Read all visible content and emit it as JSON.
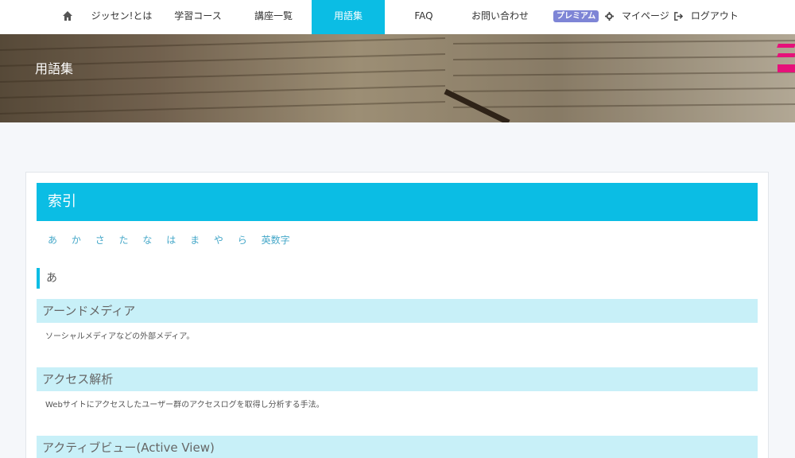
{
  "nav": {
    "home_icon": "home-icon",
    "items": [
      {
        "label": "ジッセン!とは"
      },
      {
        "label": "学習コース"
      },
      {
        "label": "講座一覧"
      },
      {
        "label": "用語集"
      },
      {
        "label": "FAQ"
      },
      {
        "label": "お問い合わせ"
      }
    ],
    "premium_badge": "プレミアム",
    "mypage_label": "マイページ",
    "logout_label": "ログアウト",
    "active_color": "#0bbde4"
  },
  "hero": {
    "title": "用語集"
  },
  "index": {
    "header": "索引",
    "letters": [
      "あ",
      "か",
      "さ",
      "た",
      "な",
      "は",
      "ま",
      "や",
      "ら",
      "英数字"
    ],
    "current_section": "あ"
  },
  "terms": [
    {
      "title": "アーンドメディア",
      "desc": "ソーシャルメディアなどの外部メディア。"
    },
    {
      "title": "アクセス解析",
      "desc": "Webサイトにアクセスしたユーザー群のアクセスログを取得し分析する手法。"
    },
    {
      "title": "アクティブビュー(Active View)",
      "desc": ""
    }
  ]
}
